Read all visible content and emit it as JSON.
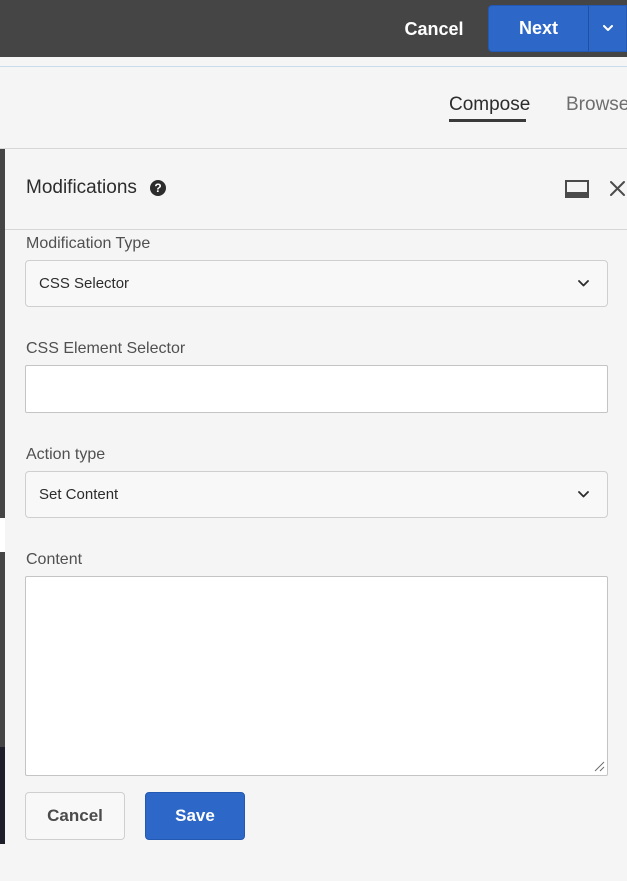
{
  "topbar": {
    "cancel_label": "Cancel",
    "next_label": "Next",
    "next_menu_icon": "chevron-down-icon"
  },
  "tabs": {
    "compose": "Compose",
    "browse": "Browse",
    "active": "compose"
  },
  "panel": {
    "title": "Modifications",
    "help_icon": "?",
    "dock_icon": "dock-icon",
    "close_icon": "close-icon"
  },
  "form": {
    "modification_type": {
      "label": "Modification Type",
      "value": "CSS Selector"
    },
    "css_selector": {
      "label": "CSS Element Selector",
      "value": ""
    },
    "action_type": {
      "label": "Action type",
      "value": "Set Content"
    },
    "content": {
      "label": "Content",
      "value": ""
    },
    "cancel_label": "Cancel",
    "save_label": "Save"
  },
  "colors": {
    "topbar": "#454545",
    "primary": "#2d67c7",
    "background": "#f5f5f5"
  }
}
